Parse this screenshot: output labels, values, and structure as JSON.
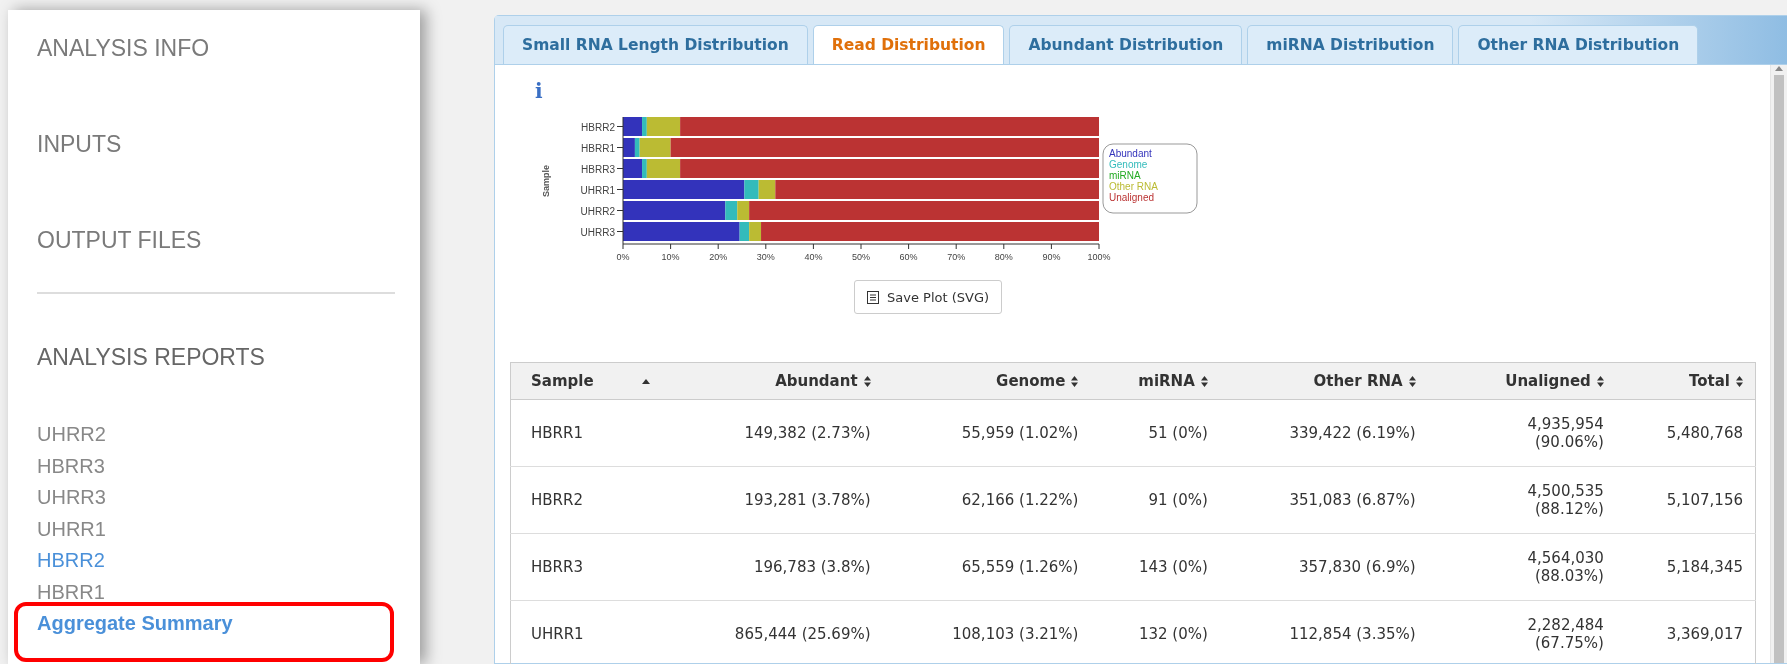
{
  "sidebar": {
    "sections": [
      {
        "label": "ANALYSIS INFO"
      },
      {
        "label": "INPUTS"
      },
      {
        "label": "OUTPUT FILES"
      }
    ],
    "reports_heading": "ANALYSIS REPORTS",
    "reports": [
      {
        "label": "UHRR2",
        "selected": false,
        "highlighted": false
      },
      {
        "label": "HBRR3",
        "selected": false,
        "highlighted": false
      },
      {
        "label": "UHRR3",
        "selected": false,
        "highlighted": false
      },
      {
        "label": "UHRR1",
        "selected": false,
        "highlighted": false
      },
      {
        "label": "HBRR2",
        "selected": false,
        "highlighted": true
      },
      {
        "label": "HBRR1",
        "selected": false,
        "highlighted": false
      },
      {
        "label": "Aggregate Summary",
        "selected": true,
        "highlighted": false
      }
    ]
  },
  "tabs": [
    {
      "label": "Small RNA Length Distribution",
      "selected": false
    },
    {
      "label": "Read Distribution",
      "selected": true
    },
    {
      "label": "Abundant Distribution",
      "selected": false
    },
    {
      "label": "miRNA Distribution",
      "selected": false
    },
    {
      "label": "Other RNA Distribution",
      "selected": false
    }
  ],
  "info_icon": "i",
  "chart_data": {
    "type": "bar",
    "orientation": "horizontal",
    "stacked": true,
    "ylabel": "Sample",
    "categories": [
      "HBRR2",
      "HBRR1",
      "HBRR3",
      "UHRR1",
      "UHRR2",
      "UHRR3"
    ],
    "xlim": [
      0,
      100
    ],
    "xticks": [
      {
        "value": 0,
        "label": "0%"
      },
      {
        "value": 10,
        "label": "10%"
      },
      {
        "value": 20,
        "label": "20%"
      },
      {
        "value": 30,
        "label": "30%"
      },
      {
        "value": 40,
        "label": "40%"
      },
      {
        "value": 50,
        "label": "50%"
      },
      {
        "value": 60,
        "label": "60%"
      },
      {
        "value": 70,
        "label": "70%"
      },
      {
        "value": 80,
        "label": "80%"
      },
      {
        "value": 90,
        "label": "90%"
      },
      {
        "value": 100,
        "label": "100%"
      }
    ],
    "series": [
      {
        "name": "Abundant",
        "color": "#3333bb",
        "values": [
          4,
          2.5,
          4,
          25.5,
          21.5,
          24.5
        ]
      },
      {
        "name": "Genome",
        "color": "#33bbbb",
        "values": [
          1,
          1,
          1,
          3,
          2.5,
          2
        ]
      },
      {
        "name": "miRNA",
        "color": "#22aa22",
        "values": [
          0,
          0,
          0,
          0,
          0,
          0
        ]
      },
      {
        "name": "Other RNA",
        "color": "#bbbb33",
        "values": [
          7,
          6.5,
          7,
          3.5,
          2.5,
          2.5
        ]
      },
      {
        "name": "Unaligned",
        "color": "#bb3333",
        "values": [
          88,
          90,
          88,
          68,
          73.5,
          71
        ]
      }
    ]
  },
  "save_button": "Save Plot (SVG)",
  "table": {
    "columns": [
      {
        "label": "Sample",
        "sorted": true
      },
      {
        "label": "Abundant",
        "sorted": false
      },
      {
        "label": "Genome",
        "sorted": false
      },
      {
        "label": "miRNA",
        "sorted": false
      },
      {
        "label": "Other RNA",
        "sorted": false
      },
      {
        "label": "Unaligned",
        "sorted": false
      },
      {
        "label": "Total",
        "sorted": false
      }
    ],
    "rows": [
      [
        "HBRR1",
        "149,382 (2.73%)",
        "55,959 (1.02%)",
        "51 (0%)",
        "339,422 (6.19%)",
        "4,935,954 (90.06%)",
        "5,480,768"
      ],
      [
        "HBRR2",
        "193,281 (3.78%)",
        "62,166 (1.22%)",
        "91 (0%)",
        "351,083 (6.87%)",
        "4,500,535 (88.12%)",
        "5,107,156"
      ],
      [
        "HBRR3",
        "196,783 (3.8%)",
        "65,559 (1.26%)",
        "143 (0%)",
        "357,830 (6.9%)",
        "4,564,030 (88.03%)",
        "5,184,345"
      ],
      [
        "UHRR1",
        "865,444 (25.69%)",
        "108,103 (3.21%)",
        "132 (0%)",
        "112,854 (3.35%)",
        "2,282,484 (67.75%)",
        "3,369,017"
      ]
    ]
  }
}
